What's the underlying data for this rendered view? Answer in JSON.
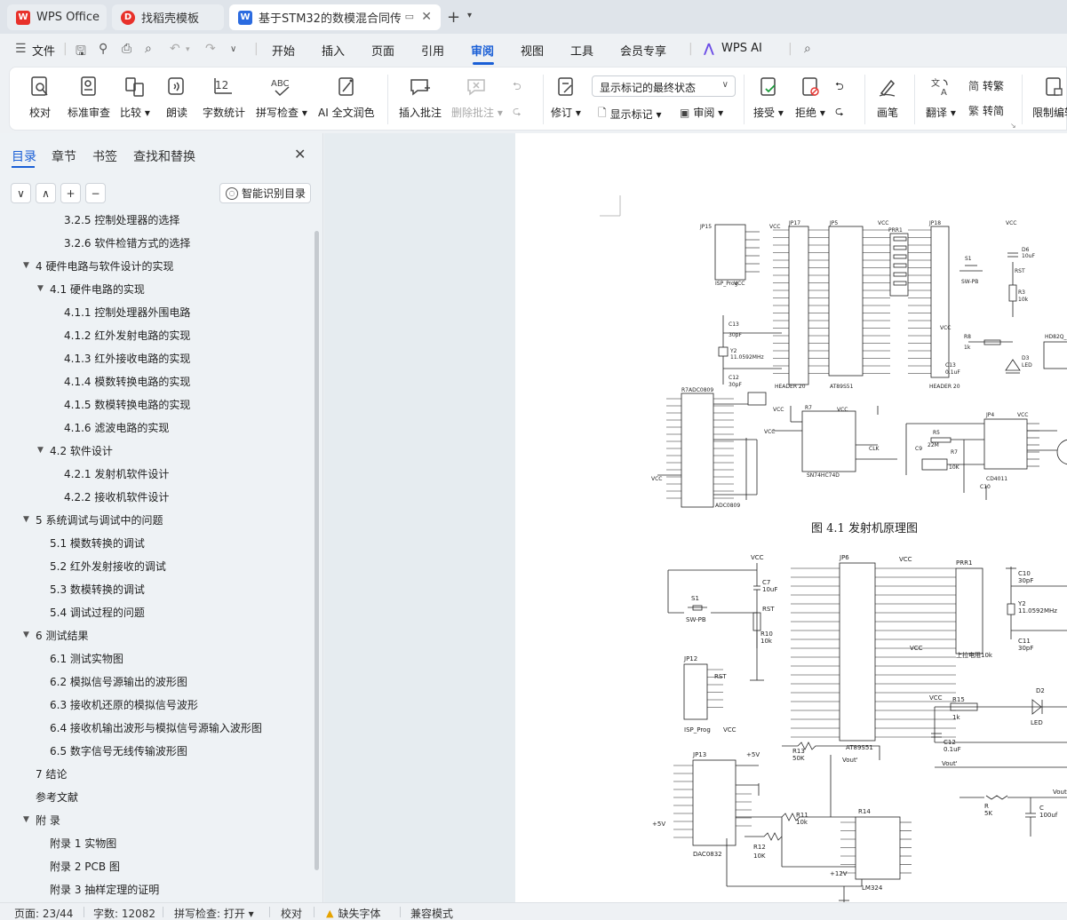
{
  "tabs": [
    {
      "label": "WPS Office",
      "icon": "wps-logo-icon"
    },
    {
      "label": "找稻壳模板",
      "icon": "docer-logo-icon"
    },
    {
      "label": "基于STM32的数模混合同传",
      "icon": "word-doc-icon"
    }
  ],
  "menu": {
    "file": "文件",
    "items": [
      "开始",
      "插入",
      "页面",
      "引用",
      "审阅",
      "视图",
      "工具",
      "会员专享"
    ],
    "active": "审阅",
    "wps_ai": "WPS AI"
  },
  "ribbon": {
    "proofread": "校对",
    "standard_review": "标准审查",
    "compare": "比较",
    "read_aloud": "朗读",
    "word_count": "字数统计",
    "spell_check": "拼写检查",
    "ai_polish": "AI 全文润色",
    "insert_comment": "插入批注",
    "delete_comment": "删除批注",
    "track_changes": "修订",
    "markup_mode": "显示标记的最终状态",
    "show_markup": "显示标记",
    "review": "审阅",
    "accept": "接受",
    "reject": "拒绝",
    "draw": "画笔",
    "translate": "翻译",
    "to_traditional": "转繁",
    "to_simplified": "转简",
    "restrict_edit": "限制编辑"
  },
  "nav": {
    "tabs": [
      "目录",
      "章节",
      "书签",
      "查找和替换"
    ],
    "active_tab": "目录",
    "smart_toc": "智能识别目录",
    "toc": [
      {
        "text": "3.2.5  控制处理器的选择",
        "level": 3
      },
      {
        "text": "3.2.6  软件检错方式的选择",
        "level": 3
      },
      {
        "text": "4  硬件电路与软件设计的实现",
        "level": 1,
        "expanded": true
      },
      {
        "text": "4.1  硬件电路的实现",
        "level": 2,
        "expanded": true
      },
      {
        "text": "4.1.1  控制处理器外围电路",
        "level": 3
      },
      {
        "text": "4.1.2  红外发射电路的实现",
        "level": 3
      },
      {
        "text": "4.1.3  红外接收电路的实现",
        "level": 3
      },
      {
        "text": "4.1.4  模数转换电路的实现",
        "level": 3
      },
      {
        "text": "4.1.5 数模转换电路的实现",
        "level": 3
      },
      {
        "text": "4.1.6 滤波电路的实现",
        "level": 3
      },
      {
        "text": "4.2  软件设计",
        "level": 2,
        "expanded": true
      },
      {
        "text": "4.2.1  发射机软件设计",
        "level": 3
      },
      {
        "text": "4.2.2  接收机软件设计",
        "level": 3
      },
      {
        "text": "5  系统调试与调试中的问题",
        "level": 1,
        "expanded": true
      },
      {
        "text": "5.1  模数转换的调试",
        "level": 2
      },
      {
        "text": "5.2  红外发射接收的调试",
        "level": 2
      },
      {
        "text": "5.3  数模转换的调试",
        "level": 2
      },
      {
        "text": "5.4  调试过程的问题",
        "level": 2
      },
      {
        "text": "6  测试结果",
        "level": 1,
        "expanded": true
      },
      {
        "text": "6.1  测试实物图",
        "level": 2
      },
      {
        "text": "6.2  模拟信号源输出的波形图",
        "level": 2
      },
      {
        "text": "6.3  接收机还原的模拟信号波形",
        "level": 2
      },
      {
        "text": "6.4  接收机输出波形与模拟信号源输入波形图",
        "level": 2
      },
      {
        "text": "6.5  数字信号无线传输波形图",
        "level": 2
      },
      {
        "text": "7  结论",
        "level": 1
      },
      {
        "text": "参考文献",
        "level": 1
      },
      {
        "text": "附  录",
        "level": 1,
        "expanded": true
      },
      {
        "text": "附录 1  实物图",
        "level": 2
      },
      {
        "text": "附录 2    PCB 图",
        "level": 2
      },
      {
        "text": "附录 3  抽样定理的证明",
        "level": 2
      }
    ]
  },
  "document": {
    "figure1_caption": "图 4.1  发射机原理图",
    "figure1_labels": {
      "isp": "ISP_Prog",
      "header20": "HEADER 20",
      "at89s51": "AT89S51",
      "sw": "SW-PB",
      "adc": "ADC0809",
      "cd4011": "CD4011",
      "sn": "SN74HC74D",
      "vcc": "VCC",
      "rst": "RST",
      "clk": "CLK",
      "r5": "22M",
      "led": "LED",
      "y1": "11.0592MHz"
    },
    "figure2_labels": {
      "jp6": "JP6",
      "jp12": "JP12",
      "jp13": "JP13",
      "s1": "S1",
      "sw": "SW-PB",
      "isp": "ISP_Prog",
      "at89s51": "AT89S51",
      "dac": "DAC0832",
      "lm324": "LM324",
      "r13": "R13",
      "r13v": "50K",
      "r11": "R11",
      "r11v": "10k",
      "r12": "R12",
      "r12v": "10K",
      "r14": "R14",
      "r10": "R10",
      "r10v": "10k",
      "c7": "C7",
      "c7v": "10uF",
      "c10": "C10",
      "c10v": "30pF",
      "c11": "C11",
      "c11v": "30pF",
      "y2": "Y2",
      "y2v": "11.0592MHz",
      "r15": "R15",
      "r15v": "1k",
      "d2": "D2",
      "led": "LED",
      "c12": "C12",
      "c12v": "0.1uF",
      "r": "R",
      "rv": "5K",
      "c": "C",
      "cv": "100uf",
      "vout": "Vout",
      "vout1": "Vout'",
      "p5v": "+5V",
      "p12v": "+12V",
      "vcc": "VCC",
      "rst": "RST",
      "prr1": "PRR1",
      "pullup": "上拉电阻10k"
    }
  },
  "status": {
    "page": "页面: 23/44",
    "words": "字数: 12082",
    "spell": "拼写检查: 打开",
    "proof": "校对",
    "font_missing": "缺失字体",
    "compat": "兼容模式"
  },
  "colors": {
    "accent": "#1a5fd6",
    "wps_red": "#e8312a",
    "word_blue": "#2b6be0"
  }
}
